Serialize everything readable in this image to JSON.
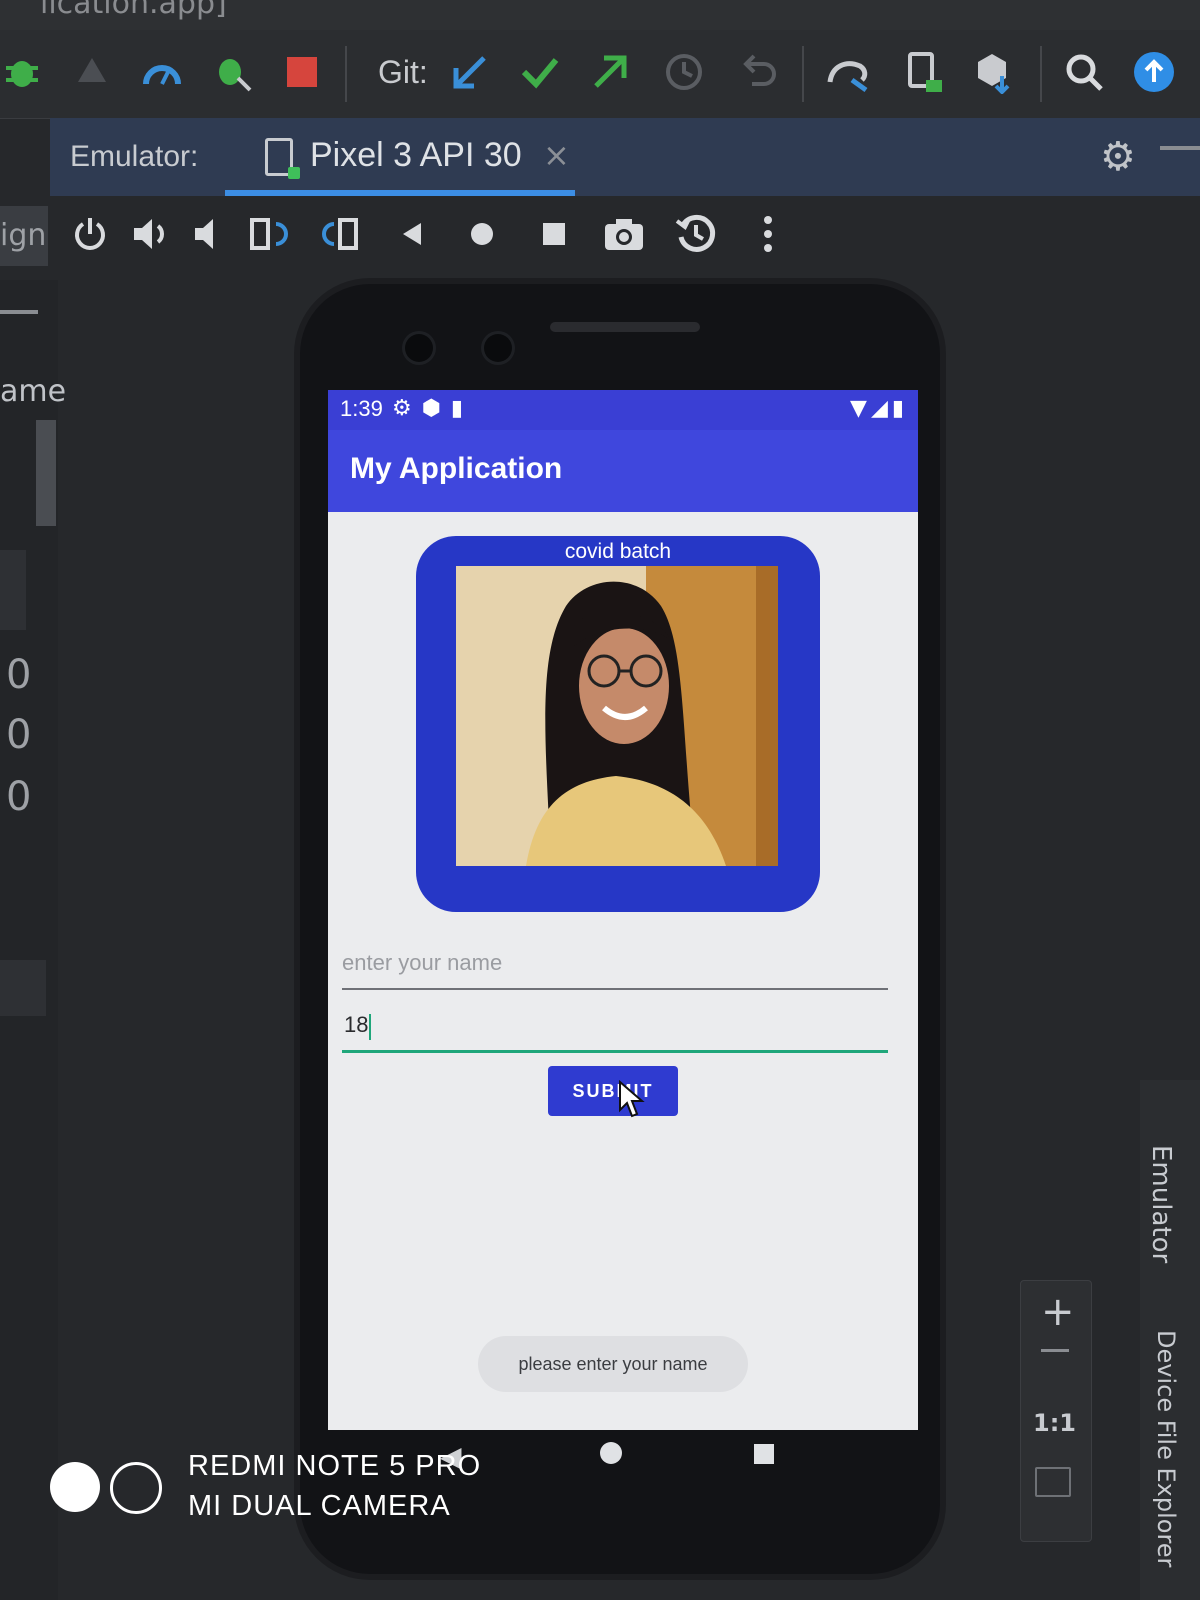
{
  "window": {
    "title_fragment": "lication.app]"
  },
  "toolbar": {
    "git_label": "Git:",
    "icons": [
      "debug-bug-icon",
      "profile-icon",
      "gauge-icon",
      "attach-debugger-icon",
      "stop-icon",
      "git-update-icon",
      "git-commit-icon",
      "git-push-icon",
      "git-history-icon",
      "git-rollback-icon",
      "gradle-sync-icon",
      "avd-manager-icon",
      "sdk-manager-icon",
      "search-icon",
      "update-icon"
    ],
    "stop_color": "#d6453d"
  },
  "emulator_panel": {
    "label": "Emulator:",
    "tab_label": "Pixel 3 API 30",
    "tab_close": "×",
    "accent": "#3c8ee5"
  },
  "emulator_controls": {
    "left_tab_fragment": "ign",
    "icons": [
      "power-icon",
      "volume-up-icon",
      "volume-down-icon",
      "rotate-left-icon",
      "rotate-right-icon",
      "back-icon",
      "home-icon",
      "overview-icon",
      "screenshot-icon",
      "snapshot-icon",
      "more-icon"
    ]
  },
  "left_panel": {
    "name_fragment": "ame",
    "zeros": [
      "0",
      "0",
      "0"
    ]
  },
  "right_strip": {
    "emulator_label": "Emulator",
    "device_explorer_label": "Device File Explorer",
    "zoom_plus": "+",
    "zoom_ratio": "1:1"
  },
  "phone": {
    "status": {
      "time": "1:39",
      "left_icons": "⚙⬢▮",
      "right_icons": "▼◢▮"
    },
    "app_title": "My Application",
    "card": {
      "caption": "covid batch",
      "color": "#2637c6"
    },
    "name_input": {
      "placeholder": "enter your name"
    },
    "age_input": {
      "value": "18"
    },
    "submit_label": "SUBMIT",
    "toast": "please enter your name",
    "primary_color": "#3f47dd"
  },
  "watermark": {
    "line1": "REDMI NOTE 5 PRO",
    "line2": "MI DUAL CAMERA"
  }
}
